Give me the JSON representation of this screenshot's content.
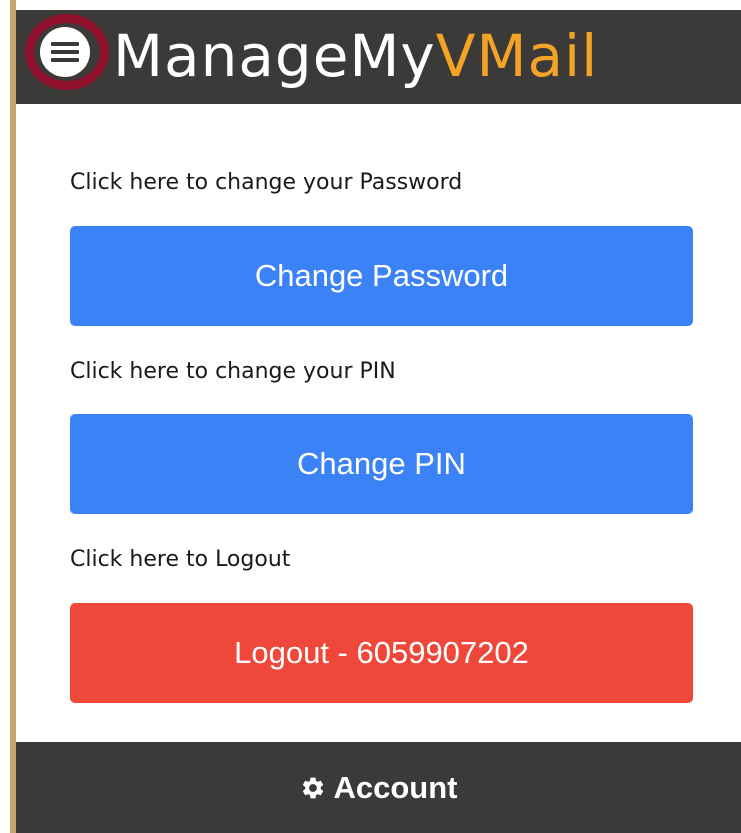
{
  "header": {
    "brand_prefix": "ManageMy",
    "brand_suffix": "VMail",
    "menu_icon": "hamburger-menu-icon"
  },
  "sections": [
    {
      "label": "Click here to change your Password",
      "button": "Change Password"
    },
    {
      "label": "Click here to change your PIN",
      "button": "Change PIN"
    },
    {
      "label": "Click here to Logout",
      "button": "Logout - 6059907202"
    }
  ],
  "footer": {
    "account_label": "Account",
    "icon": "gear-icon"
  },
  "colors": {
    "header_bg": "#3b3a39",
    "brand_accent": "#f3a325",
    "primary_button": "#3b82f6",
    "danger_button": "#ef473a",
    "highlight_ring": "#8f0f2c"
  }
}
